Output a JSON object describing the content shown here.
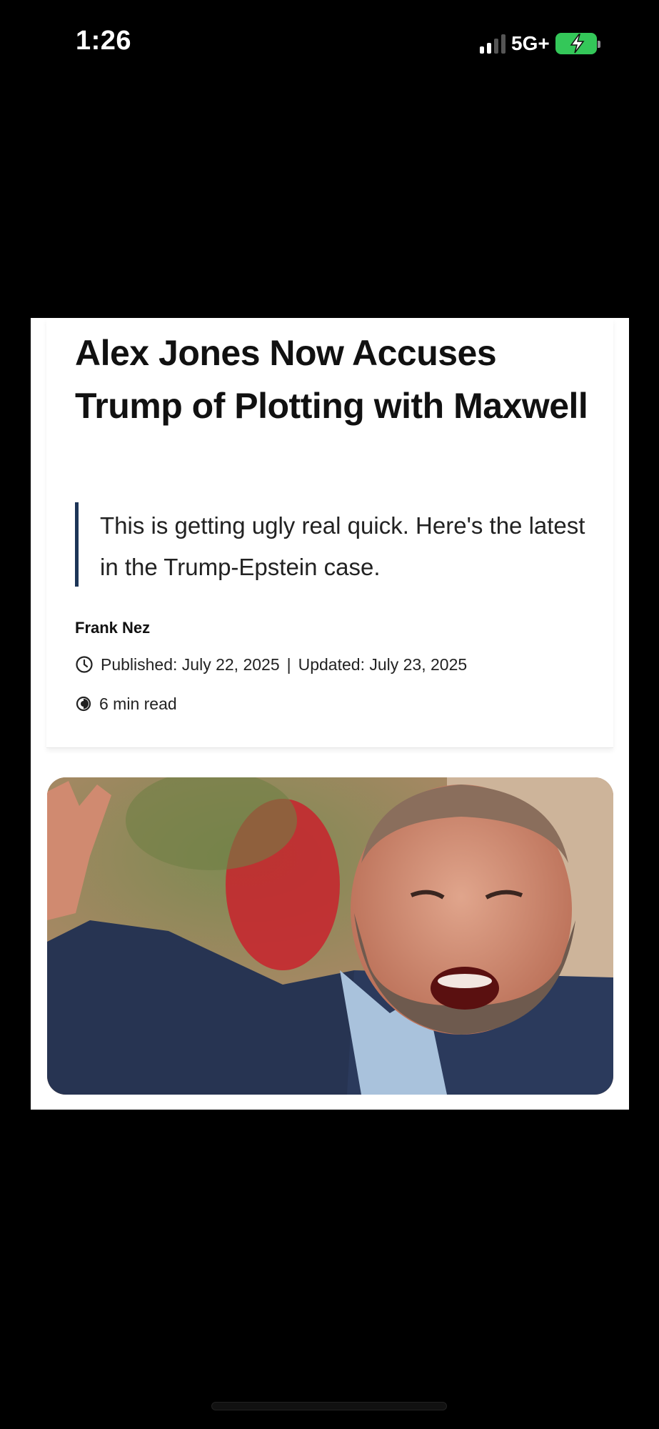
{
  "status_bar": {
    "time": "1:26",
    "network": "5G+",
    "battery_state": "charging",
    "colors": {
      "battery": "#34c759"
    }
  },
  "article": {
    "headline": "Alex Jones Now Accuses Trump of Plotting with Maxwell",
    "dek": "This is getting ugly real quick. Here's the latest in the Trump-Epstein case.",
    "author": "Frank Nez",
    "published": "Published: July 22, 2025",
    "separator": "|",
    "updated": "Updated: July 23, 2025",
    "read_time": "6 min read",
    "accent_color": "#1d3557",
    "icons": {
      "published": "clock-icon",
      "read_time": "half-circle-icon"
    }
  }
}
